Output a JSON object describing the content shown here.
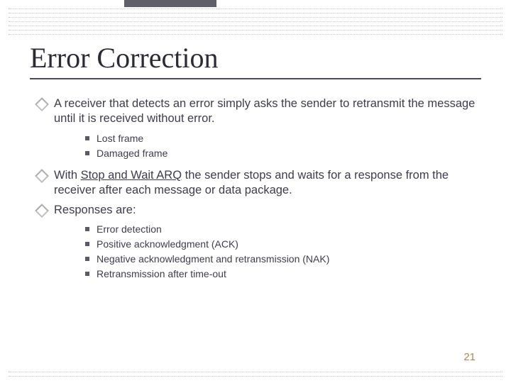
{
  "title": "Error Correction",
  "bullets": {
    "b1": "A receiver that detects an error simply asks the sender to retransmit the message until it is received without error.",
    "b1_sub": {
      "s1": "Lost frame",
      "s2": "Damaged frame"
    },
    "b2_pre": "With ",
    "b2_underline": "Stop and Wait ARQ",
    "b2_post": " the sender stops and waits for a response from the receiver after each message or data package.",
    "b3": "Responses are:",
    "b3_sub": {
      "s1": "Error detection",
      "s2": "Positive acknowledgment (ACK)",
      "s3": "Negative acknowledgment and retransmission (NAK)",
      "s4": "Retransmission after time-out"
    }
  },
  "page_number": "21"
}
